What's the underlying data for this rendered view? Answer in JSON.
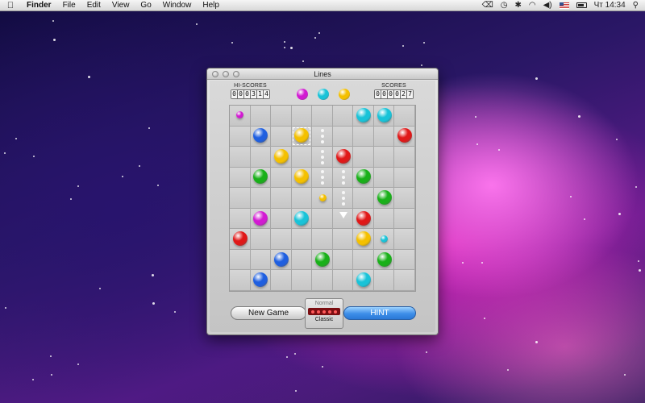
{
  "menubar": {
    "app_name": "Finder",
    "items": [
      "File",
      "Edit",
      "View",
      "Go",
      "Window",
      "Help"
    ],
    "clock": "Чт 14:34",
    "status_icons": [
      "backspace-icon",
      "clock-icon",
      "bluetooth-icon",
      "wifi-icon",
      "volume-icon",
      "flag-icon",
      "battery-icon",
      "spotlight-icon"
    ]
  },
  "window": {
    "title": "Lines",
    "hi_scores_label": "HI-SCORES",
    "hi_score_digits": [
      "0",
      "0",
      "0",
      "3",
      "1",
      "4"
    ],
    "scores_label": "SCORES",
    "score_digits": [
      "0",
      "0",
      "0",
      "0",
      "2",
      "7"
    ],
    "next_balls": [
      "magenta",
      "cyan",
      "yellow"
    ],
    "new_game_label": "New Game",
    "hint_label": "HINT",
    "mode_top": "Normal",
    "mode_bottom": "Classic"
  },
  "colors": {
    "blue": "#1f5fe0",
    "yellow": "#f4c000",
    "red": "#e01818",
    "green": "#19b019",
    "magenta": "#d21ad2",
    "cyan": "#19c3d8"
  },
  "board": {
    "size": 9,
    "balls": [
      {
        "r": 0,
        "c": 0,
        "color": "magenta",
        "size": "small"
      },
      {
        "r": 0,
        "c": 6,
        "color": "cyan",
        "size": "big"
      },
      {
        "r": 0,
        "c": 7,
        "color": "cyan",
        "size": "big"
      },
      {
        "r": 1,
        "c": 1,
        "color": "blue",
        "size": "big"
      },
      {
        "r": 1,
        "c": 3,
        "color": "yellow",
        "size": "big",
        "selected": true
      },
      {
        "r": 1,
        "c": 8,
        "color": "red",
        "size": "big"
      },
      {
        "r": 2,
        "c": 2,
        "color": "yellow",
        "size": "big"
      },
      {
        "r": 2,
        "c": 5,
        "color": "red",
        "size": "big"
      },
      {
        "r": 3,
        "c": 1,
        "color": "green",
        "size": "big"
      },
      {
        "r": 3,
        "c": 3,
        "color": "yellow",
        "size": "big"
      },
      {
        "r": 3,
        "c": 6,
        "color": "green",
        "size": "big"
      },
      {
        "r": 4,
        "c": 4,
        "color": "yellow",
        "size": "small"
      },
      {
        "r": 4,
        "c": 7,
        "color": "green",
        "size": "big"
      },
      {
        "r": 5,
        "c": 1,
        "color": "magenta",
        "size": "big"
      },
      {
        "r": 5,
        "c": 3,
        "color": "cyan",
        "size": "big"
      },
      {
        "r": 5,
        "c": 6,
        "color": "red",
        "size": "big"
      },
      {
        "r": 6,
        "c": 0,
        "color": "red",
        "size": "big"
      },
      {
        "r": 6,
        "c": 6,
        "color": "yellow",
        "size": "big"
      },
      {
        "r": 6,
        "c": 7,
        "color": "cyan",
        "size": "small"
      },
      {
        "r": 7,
        "c": 2,
        "color": "blue",
        "size": "big"
      },
      {
        "r": 7,
        "c": 4,
        "color": "green",
        "size": "big"
      },
      {
        "r": 7,
        "c": 7,
        "color": "green",
        "size": "big"
      },
      {
        "r": 8,
        "c": 1,
        "color": "blue",
        "size": "big"
      },
      {
        "r": 8,
        "c": 6,
        "color": "cyan",
        "size": "big"
      }
    ],
    "hint_path": [
      [
        1,
        4
      ],
      [
        2,
        4
      ],
      [
        3,
        4
      ],
      [
        3,
        5
      ],
      [
        4,
        5
      ]
    ],
    "hint_target": [
      5,
      5
    ]
  }
}
